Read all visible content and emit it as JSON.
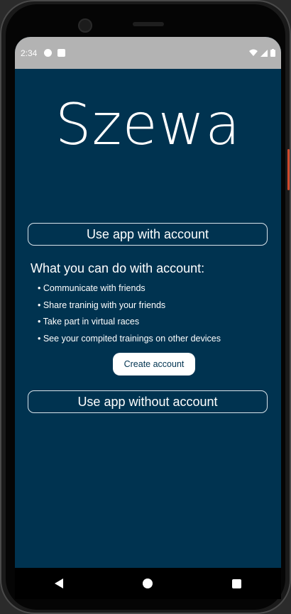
{
  "status_bar": {
    "time": "2:34",
    "icons": [
      "app-notification-icon",
      "sd-card-icon",
      "wifi-icon",
      "signal-icon",
      "battery-icon"
    ]
  },
  "app": {
    "logo": "Szewa",
    "use_with_account_label": "Use app with account",
    "features_title": "What you can do with account:",
    "features": [
      "• Communicate with friends",
      "• Share traninig with your friends",
      "• Take part in virtual races",
      "• See your compited trainings on other devices"
    ],
    "create_account_label": "Create account",
    "use_without_account_label": "Use app without account"
  },
  "nav_bar": {
    "icons": [
      "back-icon",
      "home-icon",
      "recent-apps-icon"
    ]
  },
  "colors": {
    "background": "#003350",
    "status_bar": "#b3b3b3",
    "text": "#ffffff",
    "button_fill": "#ffffff"
  }
}
